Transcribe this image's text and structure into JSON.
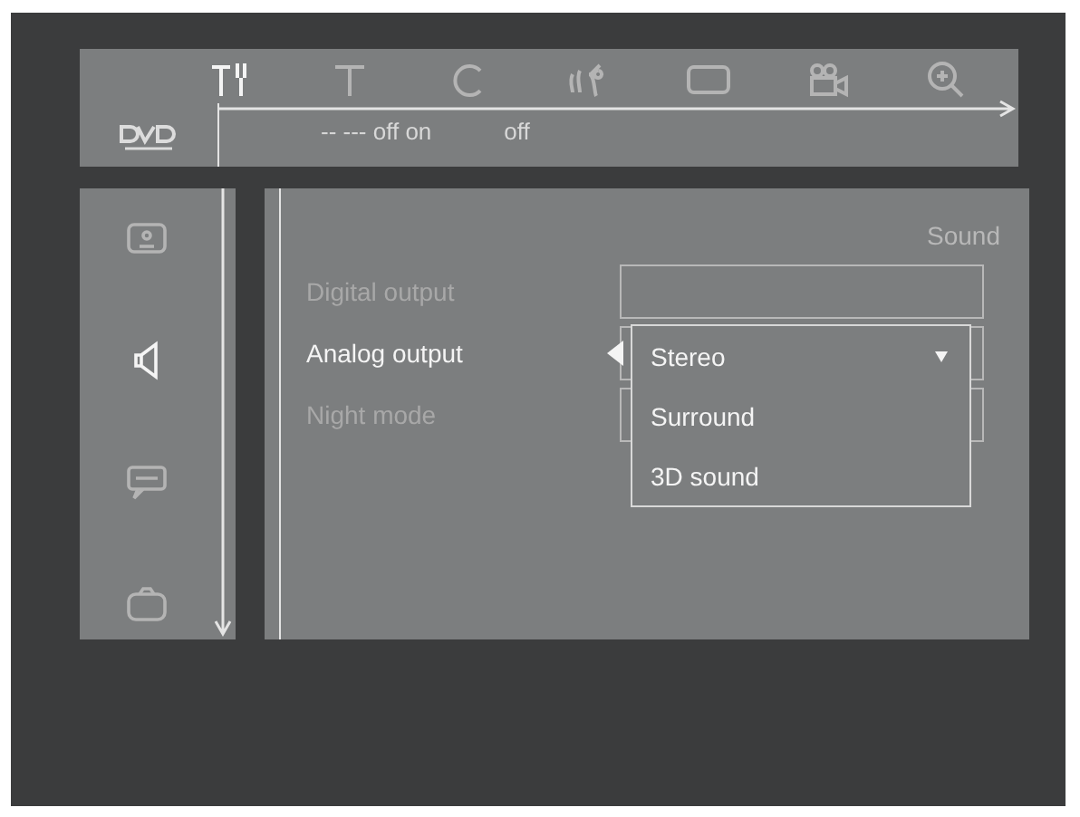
{
  "toolbar": {
    "tabs": [
      {
        "kind": "tools",
        "selected": true
      },
      {
        "kind": "t",
        "selected": false
      },
      {
        "kind": "c",
        "selected": false
      },
      {
        "kind": "voice",
        "selected": false
      },
      {
        "kind": "screen",
        "selected": false
      },
      {
        "kind": "camera",
        "selected": false
      },
      {
        "kind": "zoom",
        "selected": false
      }
    ],
    "status": [
      "-- --- off on",
      "off"
    ]
  },
  "sidebar": {
    "items": [
      {
        "kind": "picture",
        "selected": false
      },
      {
        "kind": "speaker",
        "selected": true
      },
      {
        "kind": "subtitle",
        "selected": false
      },
      {
        "kind": "tv",
        "selected": false
      }
    ]
  },
  "panel": {
    "title": "Sound",
    "settings": [
      {
        "label": "Digital output",
        "highlighted": false,
        "expanded": false
      },
      {
        "label": "Analog output",
        "highlighted": true,
        "expanded": true
      },
      {
        "label": "Night mode",
        "highlighted": false,
        "expanded": false
      }
    ],
    "options": [
      {
        "label": "Stereo",
        "selected": true
      },
      {
        "label": "Surround",
        "selected": false
      },
      {
        "label": "3D sound",
        "selected": false
      }
    ]
  }
}
